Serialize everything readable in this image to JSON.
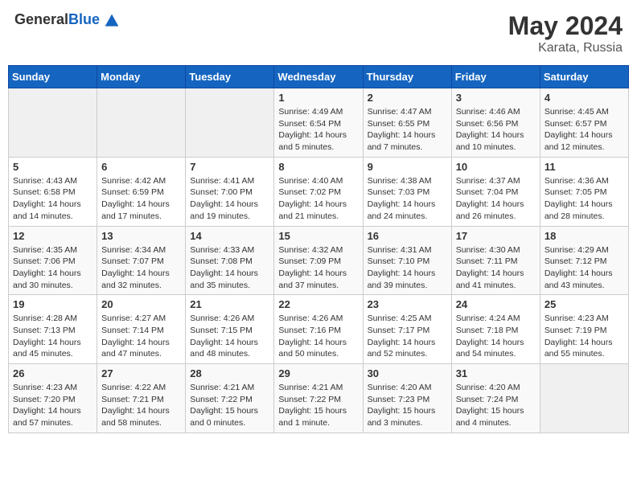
{
  "header": {
    "logo_general": "General",
    "logo_blue": "Blue",
    "title": "May 2024",
    "subtitle": "Karata, Russia"
  },
  "days_of_week": [
    "Sunday",
    "Monday",
    "Tuesday",
    "Wednesday",
    "Thursday",
    "Friday",
    "Saturday"
  ],
  "weeks": [
    [
      {
        "day": "",
        "info": ""
      },
      {
        "day": "",
        "info": ""
      },
      {
        "day": "",
        "info": ""
      },
      {
        "day": "1",
        "info": "Sunrise: 4:49 AM\nSunset: 6:54 PM\nDaylight: 14 hours\nand 5 minutes."
      },
      {
        "day": "2",
        "info": "Sunrise: 4:47 AM\nSunset: 6:55 PM\nDaylight: 14 hours\nand 7 minutes."
      },
      {
        "day": "3",
        "info": "Sunrise: 4:46 AM\nSunset: 6:56 PM\nDaylight: 14 hours\nand 10 minutes."
      },
      {
        "day": "4",
        "info": "Sunrise: 4:45 AM\nSunset: 6:57 PM\nDaylight: 14 hours\nand 12 minutes."
      }
    ],
    [
      {
        "day": "5",
        "info": "Sunrise: 4:43 AM\nSunset: 6:58 PM\nDaylight: 14 hours\nand 14 minutes."
      },
      {
        "day": "6",
        "info": "Sunrise: 4:42 AM\nSunset: 6:59 PM\nDaylight: 14 hours\nand 17 minutes."
      },
      {
        "day": "7",
        "info": "Sunrise: 4:41 AM\nSunset: 7:00 PM\nDaylight: 14 hours\nand 19 minutes."
      },
      {
        "day": "8",
        "info": "Sunrise: 4:40 AM\nSunset: 7:02 PM\nDaylight: 14 hours\nand 21 minutes."
      },
      {
        "day": "9",
        "info": "Sunrise: 4:38 AM\nSunset: 7:03 PM\nDaylight: 14 hours\nand 24 minutes."
      },
      {
        "day": "10",
        "info": "Sunrise: 4:37 AM\nSunset: 7:04 PM\nDaylight: 14 hours\nand 26 minutes."
      },
      {
        "day": "11",
        "info": "Sunrise: 4:36 AM\nSunset: 7:05 PM\nDaylight: 14 hours\nand 28 minutes."
      }
    ],
    [
      {
        "day": "12",
        "info": "Sunrise: 4:35 AM\nSunset: 7:06 PM\nDaylight: 14 hours\nand 30 minutes."
      },
      {
        "day": "13",
        "info": "Sunrise: 4:34 AM\nSunset: 7:07 PM\nDaylight: 14 hours\nand 32 minutes."
      },
      {
        "day": "14",
        "info": "Sunrise: 4:33 AM\nSunset: 7:08 PM\nDaylight: 14 hours\nand 35 minutes."
      },
      {
        "day": "15",
        "info": "Sunrise: 4:32 AM\nSunset: 7:09 PM\nDaylight: 14 hours\nand 37 minutes."
      },
      {
        "day": "16",
        "info": "Sunrise: 4:31 AM\nSunset: 7:10 PM\nDaylight: 14 hours\nand 39 minutes."
      },
      {
        "day": "17",
        "info": "Sunrise: 4:30 AM\nSunset: 7:11 PM\nDaylight: 14 hours\nand 41 minutes."
      },
      {
        "day": "18",
        "info": "Sunrise: 4:29 AM\nSunset: 7:12 PM\nDaylight: 14 hours\nand 43 minutes."
      }
    ],
    [
      {
        "day": "19",
        "info": "Sunrise: 4:28 AM\nSunset: 7:13 PM\nDaylight: 14 hours\nand 45 minutes."
      },
      {
        "day": "20",
        "info": "Sunrise: 4:27 AM\nSunset: 7:14 PM\nDaylight: 14 hours\nand 47 minutes."
      },
      {
        "day": "21",
        "info": "Sunrise: 4:26 AM\nSunset: 7:15 PM\nDaylight: 14 hours\nand 48 minutes."
      },
      {
        "day": "22",
        "info": "Sunrise: 4:26 AM\nSunset: 7:16 PM\nDaylight: 14 hours\nand 50 minutes."
      },
      {
        "day": "23",
        "info": "Sunrise: 4:25 AM\nSunset: 7:17 PM\nDaylight: 14 hours\nand 52 minutes."
      },
      {
        "day": "24",
        "info": "Sunrise: 4:24 AM\nSunset: 7:18 PM\nDaylight: 14 hours\nand 54 minutes."
      },
      {
        "day": "25",
        "info": "Sunrise: 4:23 AM\nSunset: 7:19 PM\nDaylight: 14 hours\nand 55 minutes."
      }
    ],
    [
      {
        "day": "26",
        "info": "Sunrise: 4:23 AM\nSunset: 7:20 PM\nDaylight: 14 hours\nand 57 minutes."
      },
      {
        "day": "27",
        "info": "Sunrise: 4:22 AM\nSunset: 7:21 PM\nDaylight: 14 hours\nand 58 minutes."
      },
      {
        "day": "28",
        "info": "Sunrise: 4:21 AM\nSunset: 7:22 PM\nDaylight: 15 hours\nand 0 minutes."
      },
      {
        "day": "29",
        "info": "Sunrise: 4:21 AM\nSunset: 7:22 PM\nDaylight: 15 hours\nand 1 minute."
      },
      {
        "day": "30",
        "info": "Sunrise: 4:20 AM\nSunset: 7:23 PM\nDaylight: 15 hours\nand 3 minutes."
      },
      {
        "day": "31",
        "info": "Sunrise: 4:20 AM\nSunset: 7:24 PM\nDaylight: 15 hours\nand 4 minutes."
      },
      {
        "day": "",
        "info": ""
      }
    ]
  ]
}
